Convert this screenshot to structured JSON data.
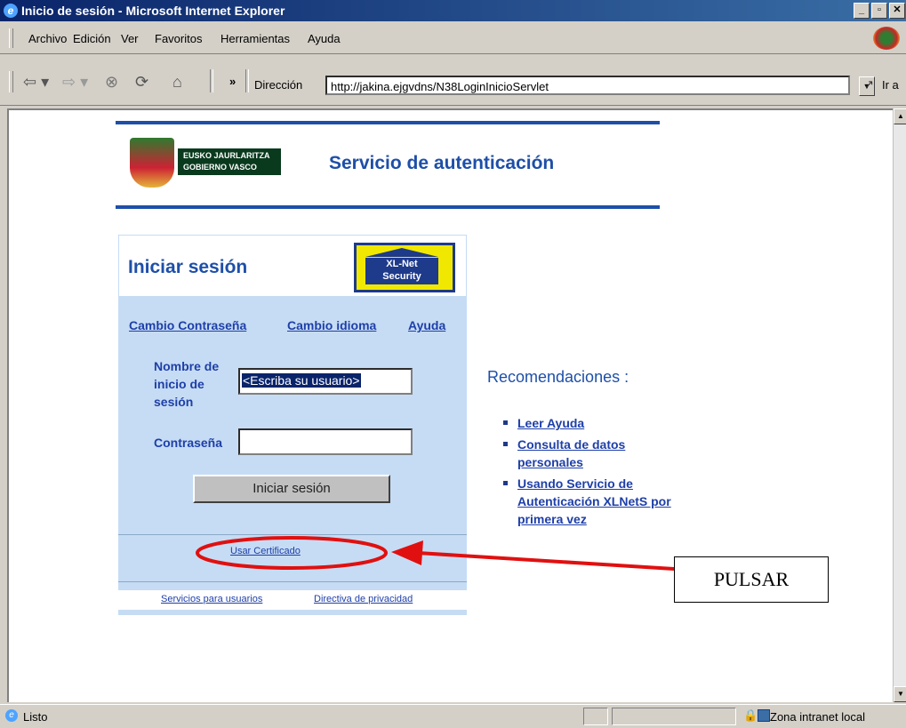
{
  "window": {
    "title": "Inicio de sesión - Microsoft Internet Explorer"
  },
  "menu": {
    "items": [
      "Archivo",
      "Edición",
      "Ver",
      "Favoritos",
      "Herramientas",
      "Ayuda"
    ]
  },
  "toolbar": {
    "chevron": "»",
    "address_label": "Dirección",
    "address_value": "http://jakina.ejgvdns/N38LoginInicioServlet",
    "go_label": "Ir a"
  },
  "header": {
    "logo_line1": "EUSKO JAURLARITZA",
    "logo_line2": "GOBIERNO VASCO",
    "service_title": "Servicio de autenticación"
  },
  "login": {
    "title": "Iniciar sesión",
    "badge_line1": "XL-Net",
    "badge_line2": "Security",
    "links": [
      "Cambio Contraseña",
      "Cambio idioma",
      "Ayuda"
    ],
    "username_label": "Nombre de inicio de sesión",
    "username_value": "<Escriba su usuario>",
    "password_label": "Contraseña",
    "submit_label": "Iniciar sesión",
    "certificate_link": "Usar Certificado",
    "footer_links": [
      "Servicios para usuarios",
      "Directiva de privacidad"
    ]
  },
  "recommendations": {
    "title": "Recomendaciones :",
    "items": [
      "Leer Ayuda",
      "Consulta de datos personales",
      "Usando Servicio de Autenticación XLNetS por primera vez"
    ]
  },
  "annotation": {
    "label": "PULSAR",
    "color": "#e01010"
  },
  "status": {
    "text": "Listo",
    "zone": "Zona intranet local"
  }
}
